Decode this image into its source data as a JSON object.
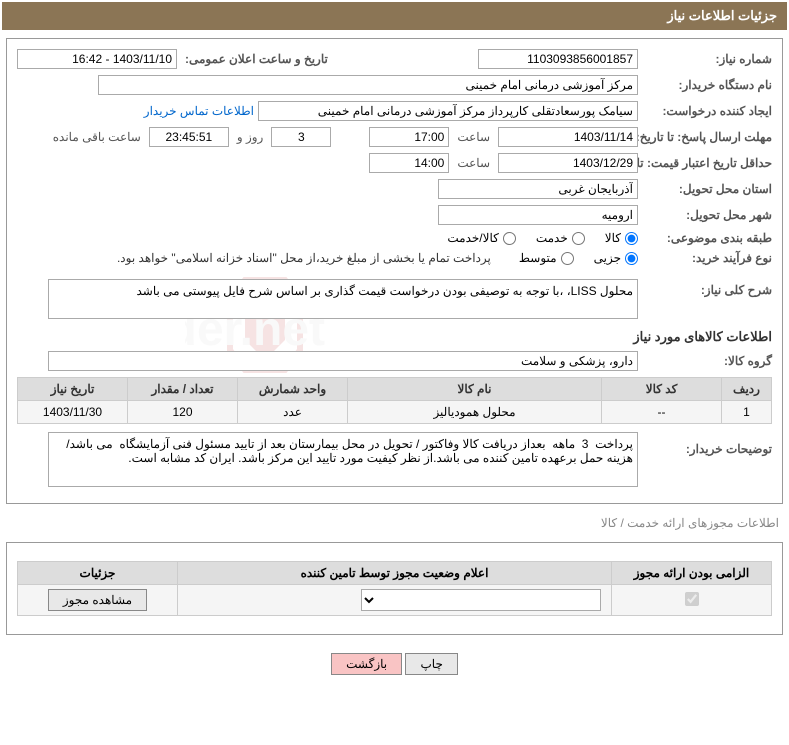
{
  "header": {
    "title": "جزئیات اطلاعات نیاز"
  },
  "form": {
    "need_number_label": "شماره نیاز:",
    "need_number": "1103093856001857",
    "announce_datetime_label": "تاریخ و ساعت اعلان عمومی:",
    "announce_datetime": "1403/11/10 - 16:42",
    "buyer_org_label": "نام دستگاه خریدار:",
    "buyer_org": "مرکز آموزشی درمانی امام خمینی",
    "requester_label": "ایجاد کننده درخواست:",
    "requester": "سیامک پورسعادتقلی کارپرداز مرکز آموزشی درمانی امام خمینی",
    "buyer_contact_link": "اطلاعات تماس خریدار",
    "deadline_label": "مهلت ارسال پاسخ: تا تاریخ:",
    "deadline_date": "1403/11/14",
    "time_label": "ساعت",
    "deadline_time": "17:00",
    "days_and_label": "روز و",
    "remaining_days": "3",
    "remaining_time": "23:45:51",
    "remaining_label": "ساعت باقی مانده",
    "validity_label": "حداقل تاریخ اعتبار قیمت: تا تاریخ:",
    "validity_date": "1403/12/29",
    "validity_time": "14:00",
    "province_label": "استان محل تحویل:",
    "province": "آذربایجان غربی",
    "city_label": "شهر محل تحویل:",
    "city": "ارومیه",
    "category_label": "طبقه بندی موضوعی:",
    "cat_good": "کالا",
    "cat_service": "خدمت",
    "cat_good_service": "کالا/خدمت",
    "purchase_type_label": "نوع فرآیند خرید:",
    "pt_partial": "جزیی",
    "pt_medium": "متوسط",
    "payment_note": "پرداخت تمام یا بخشی از مبلغ خرید،از محل \"اسناد خزانه اسلامی\" خواهد بود.",
    "desc_label": "شرح کلی نیاز:",
    "desc_text": "محلول LISS، ،با توجه به توصیفی بودن درخواست قیمت گذاری بر اساس شرح فایل پیوستی می باشد",
    "goods_section_title": "اطلاعات کالاهای مورد نیاز",
    "goods_group_label": "گروه کالا:",
    "goods_group": "دارو، پزشکی و سلامت",
    "buyer_notes_label": "توضیحات خریدار:",
    "buyer_notes": "پرداخت  3  ماهه  بعداز دریافت کالا وفاکتور / تحویل در محل بیمارستان بعد از تایید مسئول فنی آزمایشگاه  می باشد/  هزینه حمل برعهده تامین کننده می باشد.از نظر کیفیت مورد تایید این مرکز باشد. ایران کد مشابه است."
  },
  "goods_table": {
    "headers": {
      "row": "ردیف",
      "code": "کد کالا",
      "name": "نام کالا",
      "unit": "واحد شمارش",
      "qty": "تعداد / مقدار",
      "need_date": "تاریخ نیاز"
    },
    "rows": [
      {
        "row": "1",
        "code": "--",
        "name": "محلول همودیالیز",
        "unit": "عدد",
        "qty": "120",
        "need_date": "1403/11/30"
      }
    ]
  },
  "permit": {
    "section_title": "اطلاعات مجوزهای ارائه خدمت / کالا",
    "headers": {
      "mandatory": "الزامی بودن ارائه مجوز",
      "status": "اعلام وضعیت مجوز توسط تامین کننده",
      "details": "جزئیات"
    },
    "view_permit": "مشاهده مجوز"
  },
  "buttons": {
    "print": "چاپ",
    "back": "بازگشت"
  }
}
